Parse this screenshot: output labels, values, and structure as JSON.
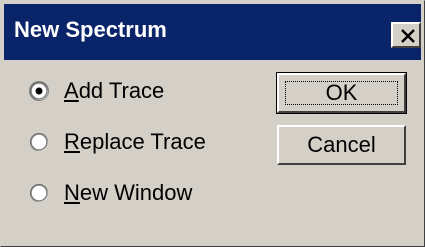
{
  "window": {
    "title": "New Spectrum",
    "close_glyph": "✕"
  },
  "options": [
    {
      "prefix": "",
      "accel": "A",
      "rest": "dd Trace",
      "checked": true
    },
    {
      "prefix": "",
      "accel": "R",
      "rest": "eplace Trace",
      "checked": false
    },
    {
      "prefix": "",
      "accel": "N",
      "rest": "ew Window",
      "checked": false
    }
  ],
  "buttons": {
    "ok_label": "OK",
    "cancel_label": "Cancel"
  }
}
